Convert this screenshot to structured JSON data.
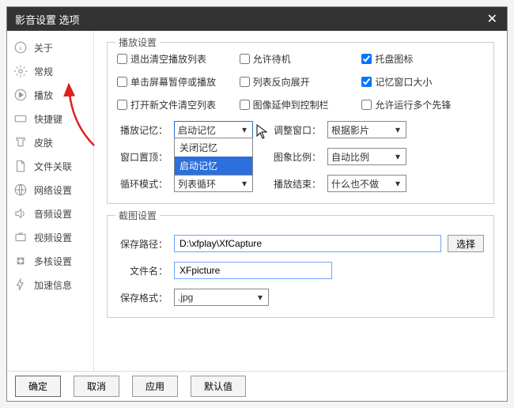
{
  "title": "影音设置 选项",
  "sidebar": {
    "items": [
      {
        "label": "关于"
      },
      {
        "label": "常规"
      },
      {
        "label": "播放"
      },
      {
        "label": "快捷键"
      },
      {
        "label": "皮肤"
      },
      {
        "label": "文件关联"
      },
      {
        "label": "网络设置"
      },
      {
        "label": "音频设置"
      },
      {
        "label": "视频设置"
      },
      {
        "label": "多核设置"
      },
      {
        "label": "加速信息"
      }
    ]
  },
  "playback": {
    "legend": "播放设置",
    "chk_exit_clear": "退出清空播放列表",
    "chk_allow_standby": "允许待机",
    "chk_tray_icon": "托盘图标",
    "chk_click_pause": "单击屏幕暂停或播放",
    "chk_list_reverse": "列表反向展开",
    "chk_remember_win": "记忆窗口大小",
    "chk_open_clear": "打开新文件清空列表",
    "chk_img_extend": "图像延伸到控制栏",
    "chk_allow_multi": "允许运行多个先锋",
    "lbl_play_memory": "播放记忆：",
    "val_play_memory": "启动记忆",
    "dd_opt1": "关闭记忆",
    "dd_opt2": "启动记忆",
    "lbl_adjust_win": "调整窗口：",
    "val_adjust_win": "根据影片",
    "lbl_win_top": "窗口置顶：",
    "lbl_img_ratio": "图象比例：",
    "val_img_ratio": "自动比例",
    "lbl_loop_mode": "循环模式：",
    "val_loop_mode": "列表循环",
    "lbl_play_end": "播放结束：",
    "val_play_end": "什么也不做"
  },
  "screenshot": {
    "legend": "截图设置",
    "lbl_save_path": "保存路径：",
    "val_save_path": "D:\\xfplay\\XfCapture",
    "btn_choose": "选择",
    "lbl_file_name": "文件名：",
    "val_file_name": "XFpicture",
    "lbl_save_fmt": "保存格式：",
    "val_save_fmt": ".jpg"
  },
  "footer": {
    "ok": "确定",
    "cancel": "取消",
    "apply": "应用",
    "default": "默认值"
  }
}
